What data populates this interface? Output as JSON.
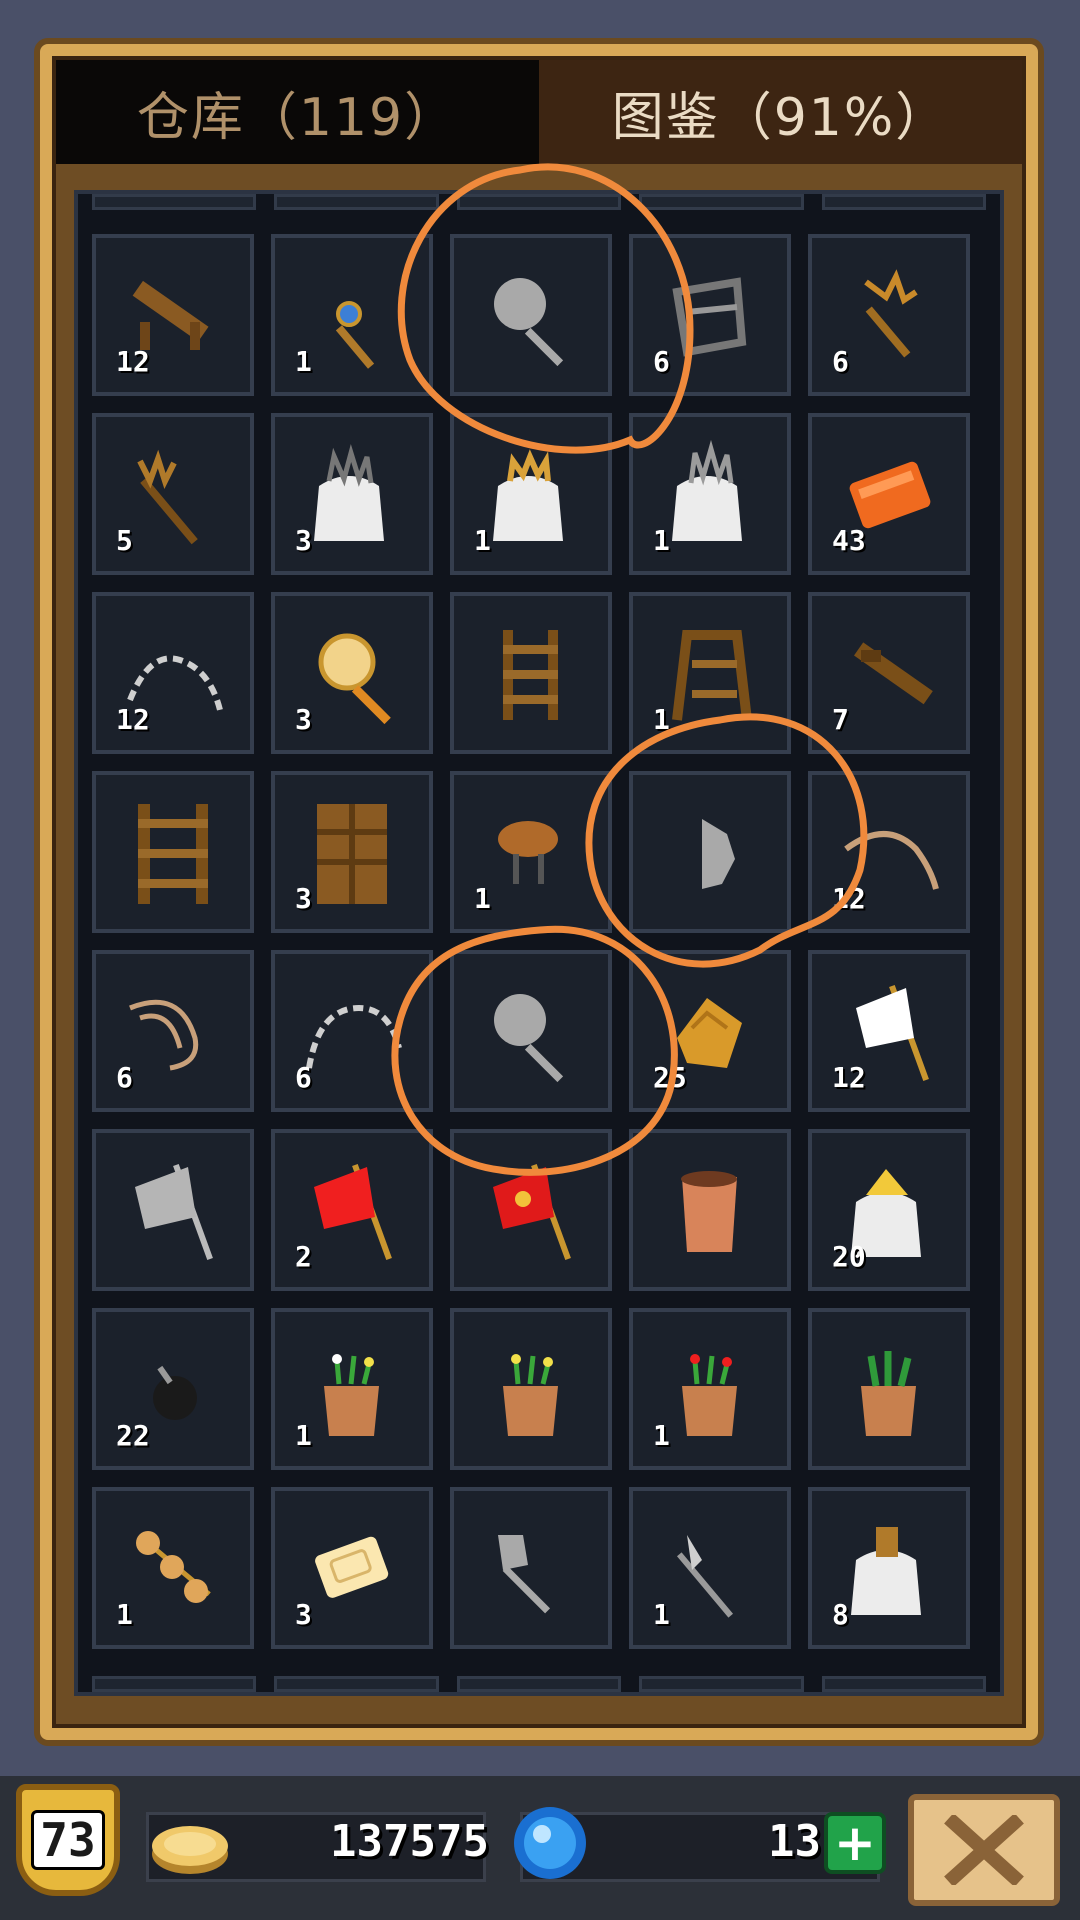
{
  "tabs": [
    {
      "label": "仓库（119）",
      "active": false
    },
    {
      "label": "图鉴（91%）",
      "active": true
    }
  ],
  "grid": {
    "slots": [
      {
        "icon": "wooden-bench-icon",
        "qty": "12"
      },
      {
        "icon": "magic-wand-icon",
        "qty": "1"
      },
      {
        "icon": "unknown-net-icon",
        "qty": ""
      },
      {
        "icon": "iron-scaffold-icon",
        "qty": "6"
      },
      {
        "icon": "gold-scepter-icon",
        "qty": "6"
      },
      {
        "icon": "golden-staff-icon",
        "qty": "5"
      },
      {
        "icon": "iron-spike-sack-icon",
        "qty": "3"
      },
      {
        "icon": "golden-crown-sack-icon",
        "qty": "1"
      },
      {
        "icon": "silver-spike-sack-icon",
        "qty": "1"
      },
      {
        "icon": "orange-brick-icon",
        "qty": "43"
      },
      {
        "icon": "chain-icon",
        "qty": "12"
      },
      {
        "icon": "golden-net-icon",
        "qty": "3"
      },
      {
        "icon": "wooden-ladder-icon",
        "qty": ""
      },
      {
        "icon": "wooden-arch-icon",
        "qty": "1"
      },
      {
        "icon": "wooden-beam-icon",
        "qty": "7"
      },
      {
        "icon": "ladder-tall-icon",
        "qty": ""
      },
      {
        "icon": "wooden-wall-icon",
        "qty": "3"
      },
      {
        "icon": "bread-stool-icon",
        "qty": "1"
      },
      {
        "icon": "unknown-shard-icon",
        "qty": ""
      },
      {
        "icon": "leather-whip-icon",
        "qty": "12"
      },
      {
        "icon": "rope-icon",
        "qty": "6"
      },
      {
        "icon": "iron-chain-icon",
        "qty": "6"
      },
      {
        "icon": "unknown-net-icon",
        "qty": ""
      },
      {
        "icon": "gold-fish-scale-icon",
        "qty": "25"
      },
      {
        "icon": "white-flag-icon",
        "qty": "12"
      },
      {
        "icon": "unknown-flag-icon",
        "qty": ""
      },
      {
        "icon": "red-flag-icon",
        "qty": "2"
      },
      {
        "icon": "red-banner-icon",
        "qty": ""
      },
      {
        "icon": "clay-pot-icon",
        "qty": ""
      },
      {
        "icon": "gold-hat-sack-icon",
        "qty": "20"
      },
      {
        "icon": "bomb-icon",
        "qty": "22"
      },
      {
        "icon": "white-flower-pot-icon",
        "qty": "1"
      },
      {
        "icon": "yellow-flower-pot-icon",
        "qty": ""
      },
      {
        "icon": "red-flower-pot-icon",
        "qty": "1"
      },
      {
        "icon": "green-plant-pot-icon",
        "qty": ""
      },
      {
        "icon": "meat-skewer-icon",
        "qty": "1"
      },
      {
        "icon": "butter-block-icon",
        "qty": "3"
      },
      {
        "icon": "unknown-shovel-icon",
        "qty": ""
      },
      {
        "icon": "pickaxe-icon",
        "qty": "1"
      },
      {
        "icon": "goods-sack-icon",
        "qty": "8"
      }
    ]
  },
  "footer": {
    "level": "73",
    "coins": "137575",
    "gems": "13",
    "plus_label": "+"
  }
}
